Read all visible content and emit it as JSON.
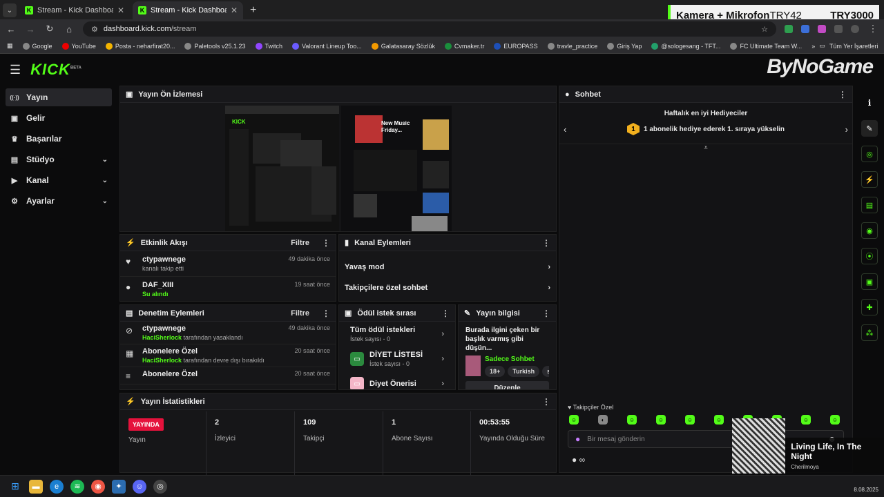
{
  "browser": {
    "tabs": [
      {
        "title": "Stream - Kick Dashboard",
        "active": false
      },
      {
        "title": "Stream - Kick Dashboard",
        "active": true
      }
    ],
    "url_domain": "dashboard.kick.com",
    "url_path": "/stream",
    "bookmarks": [
      "Google",
      "YouTube",
      "Posta - neharfirat20...",
      "Paletools v25.1.23",
      "Twitch",
      "Valorant Lineup Too...",
      "Galatasaray Sözlük",
      "Cvmaker.tr",
      "EUROPASS",
      "travle_practice",
      "Giriş Yap",
      "@sologesang - TFT...",
      "FC Ultimate Team W..."
    ],
    "bookmarks_all": "Tüm Yer İşaretleri"
  },
  "overlay": {
    "camera_label": "Kamera + Mikrofon",
    "code1": "TRY42",
    "code2": "TRY3000",
    "brand": "ByNoGame"
  },
  "kick": {
    "logo": "KICK",
    "beta": "BETA"
  },
  "sidebar": {
    "items": [
      {
        "label": "Yayın",
        "icon": "broadcast-icon",
        "glyph": "((·))",
        "chevron": false,
        "active": true
      },
      {
        "label": "Gelir",
        "icon": "wallet-icon",
        "glyph": "▣",
        "chevron": false,
        "active": false
      },
      {
        "label": "Başarılar",
        "icon": "trophy-icon",
        "glyph": "♛",
        "chevron": false,
        "active": false
      },
      {
        "label": "Stüdyo",
        "icon": "studio-icon",
        "glyph": "▤",
        "chevron": true,
        "active": false
      },
      {
        "label": "Kanal",
        "icon": "channel-icon",
        "glyph": "▶",
        "chevron": true,
        "active": false
      },
      {
        "label": "Ayarlar",
        "icon": "gear-icon",
        "glyph": "⚙",
        "chevron": true,
        "active": false
      }
    ]
  },
  "preview": {
    "title": "Yayın Ön İzlemesi",
    "inner_text": [
      "New Music",
      "Friday..."
    ]
  },
  "activity": {
    "title": "Etkinlik Akışı",
    "filter": "Filtre",
    "items": [
      {
        "name": "ctypawnege",
        "sub": "kanalı takip etti",
        "time": "49 dakika önce"
      },
      {
        "name": "DAF_XIII",
        "sub": "Su alındı",
        "time": "19 saat önce"
      }
    ]
  },
  "channel_actions": {
    "title": "Kanal Eylemleri",
    "items": [
      "Yavaş mod",
      "Takipçilere özel sohbet"
    ]
  },
  "moderation": {
    "title": "Denetim Eylemleri",
    "filter": "Filtre",
    "items": [
      {
        "name": "ctypawnege",
        "by": "HaciSherlock",
        "rest": "tarafından yasaklandı",
        "time": "49 dakika önce"
      },
      {
        "name": "Abonelere Özel",
        "by": "HaciSherlock",
        "rest": "tarafından devre dışı bırakıldı",
        "time": "20 saat önce"
      },
      {
        "name": "Abonelere Özel",
        "by": "",
        "rest": "",
        "time": "20 saat önce"
      }
    ]
  },
  "rewards": {
    "title": "Ödül istek sırası",
    "items": [
      {
        "name": "Tüm ödül istekleri",
        "sub": "İstek sayısı - 0"
      },
      {
        "name": "DİYET LİSTESİ",
        "sub": "İstek sayısı - 0"
      },
      {
        "name": "Diyet Önerisi",
        "sub": ""
      }
    ]
  },
  "stream_info": {
    "title": "Yayın bilgisi",
    "desc": "Burada ilgini çeken bir başlık varmış gibi düşün...",
    "category": "Sadece Sohbet",
    "tags": [
      "18+",
      "Turkish",
      "soh"
    ],
    "edit": "Düzenle"
  },
  "stats": {
    "title": "Yayın İstatistikleri",
    "live_badge": "YAYINDA",
    "items": [
      {
        "value": "",
        "label": "Yayın"
      },
      {
        "value": "2",
        "label": "İzleyici"
      },
      {
        "value": "109",
        "label": "Takipçi"
      },
      {
        "value": "1",
        "label": "Abone Sayısı"
      },
      {
        "value": "00:53:55",
        "label": "Yayında Olduğu Süre"
      }
    ]
  },
  "chat": {
    "title": "Sohbet",
    "gifters_title": "Haftalık en iyi Hediyeciler",
    "rank": "1",
    "gifters_text": "1 abonelik hediye ederek 1. sıraya yükselin",
    "follower_only": "Takipçiler Özel",
    "placeholder": "Bir mesaj gönderin",
    "infinity": "∞"
  },
  "music": {
    "title": "Living Life, In The Night",
    "artist": "Cherilmoya"
  },
  "taskbar": {
    "date": "8.08.2025"
  },
  "colors": {
    "accent": "#53fc18",
    "live": "#e5123c"
  }
}
